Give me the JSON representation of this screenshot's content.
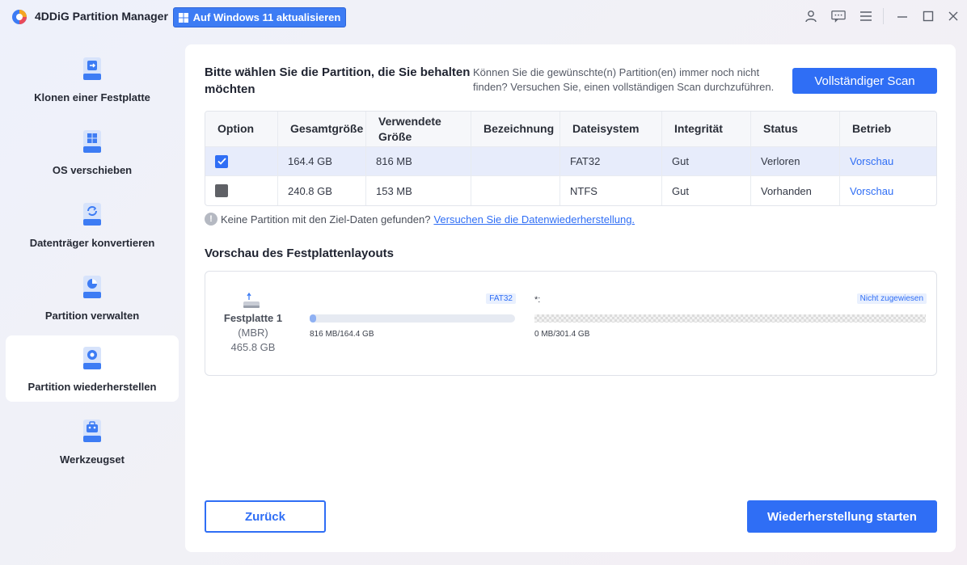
{
  "app": {
    "title": "4DDiG Partition Manager",
    "upgrade_label": "Auf Windows 11 aktualisieren",
    "icons": [
      "user-icon",
      "feedback-icon",
      "menu-icon",
      "minimize-icon",
      "maximize-icon",
      "close-icon"
    ]
  },
  "sidebar": {
    "items": [
      {
        "label": "Klonen einer Festplatte",
        "icon": "clone-disk-icon",
        "active": false
      },
      {
        "label": "OS verschieben",
        "icon": "windows-os-icon",
        "active": false
      },
      {
        "label": "Datenträger konvertieren",
        "icon": "convert-disk-icon",
        "active": false
      },
      {
        "label": "Partition verwalten",
        "icon": "pie-chart-icon",
        "active": false
      },
      {
        "label": "Partition wiederherstellen",
        "icon": "recover-partition-icon",
        "active": true
      },
      {
        "label": "Werkzeugset",
        "icon": "toolbox-icon",
        "active": false
      }
    ]
  },
  "main": {
    "heading": "Bitte wählen Sie die Partition, die Sie behalten möchten",
    "hint": "Können Sie die gewünschte(n) Partition(en) immer noch nicht finden? Versuchen Sie, einen vollständigen Scan durchzuführen.",
    "scan_label": "Vollständiger Scan",
    "table": {
      "headers": [
        "Option",
        "Gesamtgröße",
        "Verwendete Größe",
        "Bezeichnung",
        "Dateisystem",
        "Integrität",
        "Status",
        "Betrieb"
      ],
      "rows": [
        {
          "checked": true,
          "total": "164.4 GB",
          "used": "816 MB",
          "label": "",
          "fs": "FAT32",
          "integrity": "Gut",
          "status": "Verloren",
          "action": "Vorschau"
        },
        {
          "checked": false,
          "total": "240.8 GB",
          "used": "153 MB",
          "label": "",
          "fs": "NTFS",
          "integrity": "Gut",
          "status": "Vorhanden",
          "action": "Vorschau"
        }
      ]
    },
    "notice_text": "Keine Partition mit den Ziel-Daten gefunden?",
    "notice_link": "Versuchen Sie die Datenwiederherstellung.",
    "layout_title": "Vorschau des Festplattenlayouts",
    "disk": {
      "name": "Festplatte 1",
      "type": "(MBR)",
      "size": "465.8 GB",
      "partitions": [
        {
          "tag": "FAT32",
          "label": "",
          "usage": "816 MB/164.4 GB",
          "fill_fraction": 0.005
        },
        {
          "tag": "Nicht zugewiesen",
          "label": "*:",
          "usage": "0 MB/301.4 GB",
          "fill_fraction": 0
        }
      ]
    },
    "back_label": "Zurück",
    "start_label": "Wiederherstellung starten"
  },
  "colors": {
    "accent": "#2f6ef5",
    "selected_row": "#e7ecfb"
  }
}
